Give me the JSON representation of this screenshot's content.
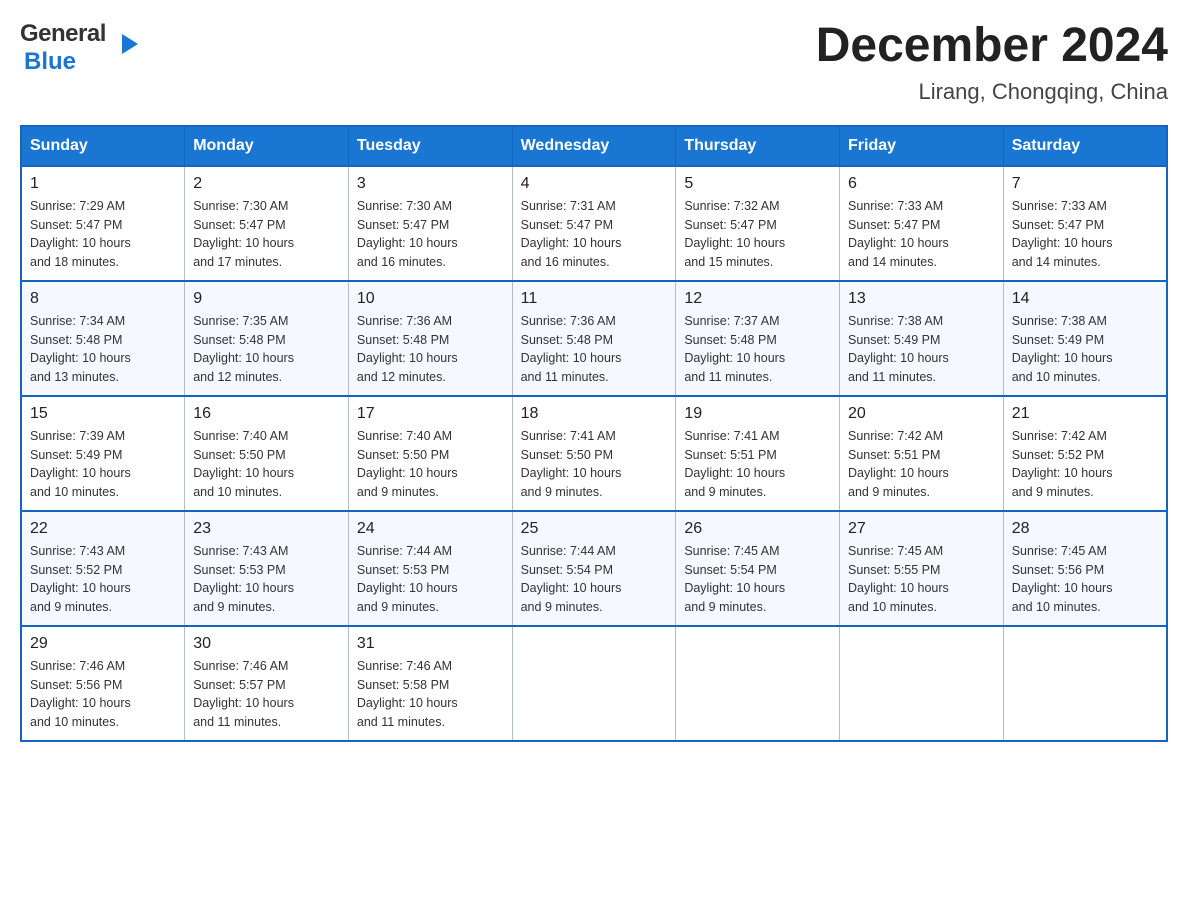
{
  "header": {
    "logo_general": "General",
    "logo_blue": "Blue",
    "month_title": "December 2024",
    "location": "Lirang, Chongqing, China"
  },
  "days_of_week": [
    "Sunday",
    "Monday",
    "Tuesday",
    "Wednesday",
    "Thursday",
    "Friday",
    "Saturday"
  ],
  "weeks": [
    [
      {
        "day": "1",
        "sunrise": "7:29 AM",
        "sunset": "5:47 PM",
        "daylight": "10 hours and 18 minutes."
      },
      {
        "day": "2",
        "sunrise": "7:30 AM",
        "sunset": "5:47 PM",
        "daylight": "10 hours and 17 minutes."
      },
      {
        "day": "3",
        "sunrise": "7:30 AM",
        "sunset": "5:47 PM",
        "daylight": "10 hours and 16 minutes."
      },
      {
        "day": "4",
        "sunrise": "7:31 AM",
        "sunset": "5:47 PM",
        "daylight": "10 hours and 16 minutes."
      },
      {
        "day": "5",
        "sunrise": "7:32 AM",
        "sunset": "5:47 PM",
        "daylight": "10 hours and 15 minutes."
      },
      {
        "day": "6",
        "sunrise": "7:33 AM",
        "sunset": "5:47 PM",
        "daylight": "10 hours and 14 minutes."
      },
      {
        "day": "7",
        "sunrise": "7:33 AM",
        "sunset": "5:47 PM",
        "daylight": "10 hours and 14 minutes."
      }
    ],
    [
      {
        "day": "8",
        "sunrise": "7:34 AM",
        "sunset": "5:48 PM",
        "daylight": "10 hours and 13 minutes."
      },
      {
        "day": "9",
        "sunrise": "7:35 AM",
        "sunset": "5:48 PM",
        "daylight": "10 hours and 12 minutes."
      },
      {
        "day": "10",
        "sunrise": "7:36 AM",
        "sunset": "5:48 PM",
        "daylight": "10 hours and 12 minutes."
      },
      {
        "day": "11",
        "sunrise": "7:36 AM",
        "sunset": "5:48 PM",
        "daylight": "10 hours and 11 minutes."
      },
      {
        "day": "12",
        "sunrise": "7:37 AM",
        "sunset": "5:48 PM",
        "daylight": "10 hours and 11 minutes."
      },
      {
        "day": "13",
        "sunrise": "7:38 AM",
        "sunset": "5:49 PM",
        "daylight": "10 hours and 11 minutes."
      },
      {
        "day": "14",
        "sunrise": "7:38 AM",
        "sunset": "5:49 PM",
        "daylight": "10 hours and 10 minutes."
      }
    ],
    [
      {
        "day": "15",
        "sunrise": "7:39 AM",
        "sunset": "5:49 PM",
        "daylight": "10 hours and 10 minutes."
      },
      {
        "day": "16",
        "sunrise": "7:40 AM",
        "sunset": "5:50 PM",
        "daylight": "10 hours and 10 minutes."
      },
      {
        "day": "17",
        "sunrise": "7:40 AM",
        "sunset": "5:50 PM",
        "daylight": "10 hours and 9 minutes."
      },
      {
        "day": "18",
        "sunrise": "7:41 AM",
        "sunset": "5:50 PM",
        "daylight": "10 hours and 9 minutes."
      },
      {
        "day": "19",
        "sunrise": "7:41 AM",
        "sunset": "5:51 PM",
        "daylight": "10 hours and 9 minutes."
      },
      {
        "day": "20",
        "sunrise": "7:42 AM",
        "sunset": "5:51 PM",
        "daylight": "10 hours and 9 minutes."
      },
      {
        "day": "21",
        "sunrise": "7:42 AM",
        "sunset": "5:52 PM",
        "daylight": "10 hours and 9 minutes."
      }
    ],
    [
      {
        "day": "22",
        "sunrise": "7:43 AM",
        "sunset": "5:52 PM",
        "daylight": "10 hours and 9 minutes."
      },
      {
        "day": "23",
        "sunrise": "7:43 AM",
        "sunset": "5:53 PM",
        "daylight": "10 hours and 9 minutes."
      },
      {
        "day": "24",
        "sunrise": "7:44 AM",
        "sunset": "5:53 PM",
        "daylight": "10 hours and 9 minutes."
      },
      {
        "day": "25",
        "sunrise": "7:44 AM",
        "sunset": "5:54 PM",
        "daylight": "10 hours and 9 minutes."
      },
      {
        "day": "26",
        "sunrise": "7:45 AM",
        "sunset": "5:54 PM",
        "daylight": "10 hours and 9 minutes."
      },
      {
        "day": "27",
        "sunrise": "7:45 AM",
        "sunset": "5:55 PM",
        "daylight": "10 hours and 10 minutes."
      },
      {
        "day": "28",
        "sunrise": "7:45 AM",
        "sunset": "5:56 PM",
        "daylight": "10 hours and 10 minutes."
      }
    ],
    [
      {
        "day": "29",
        "sunrise": "7:46 AM",
        "sunset": "5:56 PM",
        "daylight": "10 hours and 10 minutes."
      },
      {
        "day": "30",
        "sunrise": "7:46 AM",
        "sunset": "5:57 PM",
        "daylight": "10 hours and 11 minutes."
      },
      {
        "day": "31",
        "sunrise": "7:46 AM",
        "sunset": "5:58 PM",
        "daylight": "10 hours and 11 minutes."
      },
      null,
      null,
      null,
      null
    ]
  ],
  "labels": {
    "sunrise": "Sunrise:",
    "sunset": "Sunset:",
    "daylight": "Daylight:"
  }
}
